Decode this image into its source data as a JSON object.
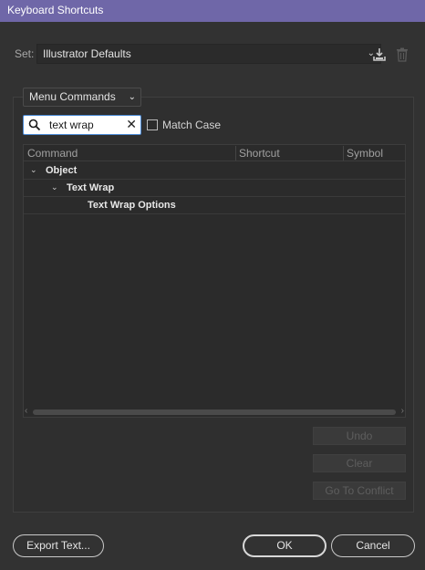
{
  "window": {
    "title": "Keyboard Shortcuts"
  },
  "set": {
    "label": "Set:",
    "value": "Illustrator Defaults"
  },
  "icons": {
    "save": "save-icon",
    "delete": "trash-icon",
    "search": "search-icon",
    "clear": "close-icon",
    "chevron": "chevron-down-icon"
  },
  "commands_dropdown": {
    "value": "Menu Commands"
  },
  "search": {
    "value": "text wrap",
    "clear_glyph": "✕"
  },
  "match_case": {
    "label": "Match Case",
    "checked": false
  },
  "table": {
    "columns": [
      "Command",
      "Shortcut",
      "Symbol"
    ],
    "rows": [
      {
        "label": "Object",
        "expanded": true,
        "level": 0
      },
      {
        "label": "Text Wrap",
        "expanded": true,
        "level": 1
      },
      {
        "label": "Text Wrap Options",
        "level": 2
      }
    ]
  },
  "side_buttons": {
    "undo": "Undo",
    "clear": "Clear",
    "go_to_conflict": "Go To Conflict"
  },
  "footer": {
    "export": "Export Text...",
    "ok": "OK",
    "cancel": "Cancel"
  },
  "colors": {
    "titlebar": "#6f67a8",
    "background": "#323232",
    "focus": "#4b8ad6"
  }
}
